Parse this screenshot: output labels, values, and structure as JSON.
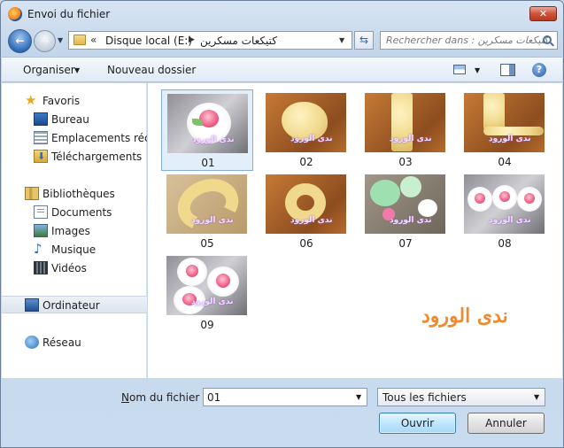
{
  "window": {
    "title": "Envoi du fichier"
  },
  "address": {
    "overflow": "«",
    "crumb1": "Disque local (E:)",
    "crumb2": "كتيكعات مسكرين"
  },
  "search": {
    "placeholder": "Rechercher dans : كتيكعات مسكرين"
  },
  "toolbar": {
    "organize": "Organiser",
    "new_folder": "Nouveau dossier",
    "help": "?"
  },
  "nav": {
    "favorites": "Favoris",
    "desktop": "Bureau",
    "recent_places": "Emplacements récents",
    "downloads": "Téléchargements",
    "libraries": "Bibliothèques",
    "documents": "Documents",
    "images": "Images",
    "music": "Musique",
    "videos": "Vidéos",
    "computer": "Ordinateur",
    "network": "Réseau"
  },
  "files": [
    "01",
    "02",
    "03",
    "04",
    "05",
    "06",
    "07",
    "08",
    "09"
  ],
  "thumb_watermark": "ندى الورود",
  "watermark": "ندى الورود",
  "bottom": {
    "filename_label_mnemonic": "N",
    "filename_label_rest": "om du fichier :",
    "filename_value": "01",
    "filetype_value": "Tous les fichiers",
    "open_button": "Ouvrir",
    "cancel_button": "Annuler"
  }
}
